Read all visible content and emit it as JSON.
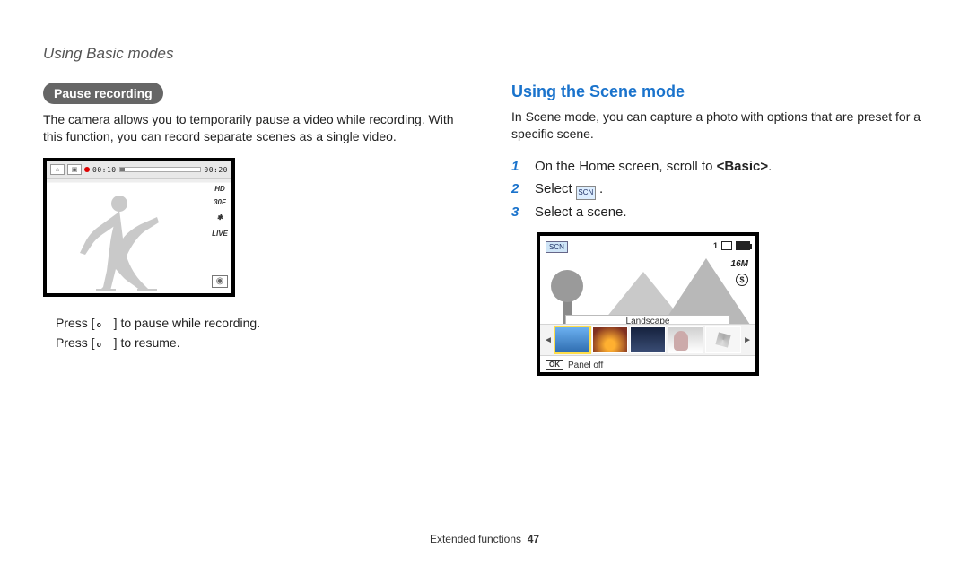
{
  "header": {
    "title": "Using Basic modes"
  },
  "left": {
    "subhead": "Pause recording",
    "para": "The camera allows you to temporarily pause a video while recording. With this function, you can record separate scenes as a single video.",
    "lcd": {
      "time_elapsed": "00:10",
      "time_total": "00:20",
      "hd": "HD",
      "fps": "30F",
      "live": "LIVE"
    },
    "caption1_pre": "Press [",
    "caption1_post": "] to pause while recording.",
    "caption2_pre": "Press [",
    "caption2_post": "] to resume.",
    "ok": "o"
  },
  "right": {
    "title": "Using the Scene mode",
    "para": "In Scene mode, you can capture a photo with options that are preset for a specific scene.",
    "steps": [
      {
        "num": "1",
        "text_pre": "On the Home screen, scroll to ",
        "bold": "<Basic>",
        "text_post": "."
      },
      {
        "num": "2",
        "text_pre": "Select ",
        "text_post": " .",
        "has_icon": true
      },
      {
        "num": "3",
        "text_pre": "Select a scene.",
        "text_post": ""
      }
    ],
    "scn_label": "SCN",
    "count": "1",
    "res": "16M",
    "flash": "$",
    "carousel_label": "Landscape",
    "panel_off_label": "Panel off",
    "ok_chip": "OK"
  },
  "footer": {
    "section": "Extended functions",
    "page": "47"
  }
}
